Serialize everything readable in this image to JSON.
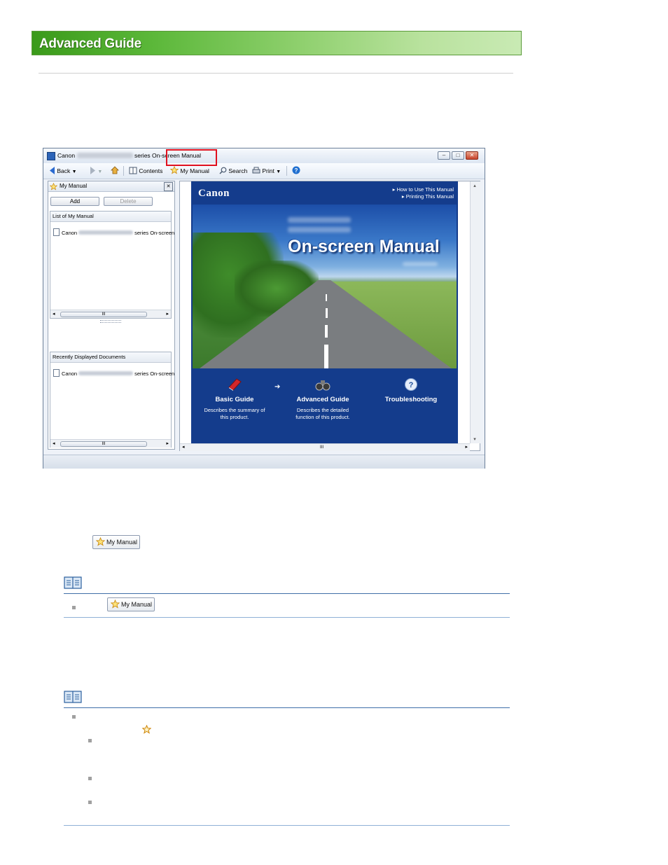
{
  "header": {
    "title": "Advanced Guide"
  },
  "window": {
    "title_prefix": "Canon",
    "title_suffix": "series On-screen Manual",
    "controls": [
      "–",
      "□",
      "✕"
    ],
    "toolbar": {
      "back": "Back",
      "contents": "Contents",
      "my_manual": "My Manual",
      "search": "Search",
      "print": "Print"
    },
    "left_pane": {
      "title": "My Manual",
      "close": "✕",
      "add_button": "Add",
      "delete_button": "Delete",
      "list_header": "List of My Manual",
      "list_item_prefix": "Canon",
      "list_item_suffix": "series On-screen",
      "recent_header": "Recently Displayed Documents",
      "recent_item_prefix": "Canon",
      "recent_item_suffix": "series On-screen",
      "scroll_thumb": "III"
    },
    "manual_page": {
      "logo": "Canon",
      "link_how_to_use": "How to Use This Manual",
      "link_printing": "Printing This Manual",
      "hero_title": "On-screen Manual",
      "categories": [
        {
          "name": "Basic Guide",
          "desc_1": "Describes the summary of",
          "desc_2": "this product."
        },
        {
          "name": "Advanced Guide",
          "desc_1": "Describes the detailed",
          "desc_2": "function of this product."
        },
        {
          "name": "Troubleshooting",
          "desc_1": "",
          "desc_2": ""
        }
      ],
      "scroll_thumb": "III"
    }
  },
  "body": {
    "my_manual_button": "My Manual",
    "note_my_manual_button": "My Manual"
  },
  "colors": {
    "banner_green": "#5cb83a",
    "highlight_red": "#e0101e",
    "manual_blue": "#143c8c",
    "rule_blue": "#3f6fa8"
  },
  "icons": [
    "book-note-icon",
    "star-icon",
    "back-arrow-icon",
    "forward-arrow-icon",
    "home-icon",
    "contents-icon",
    "search-icon",
    "print-icon",
    "help-icon"
  ]
}
